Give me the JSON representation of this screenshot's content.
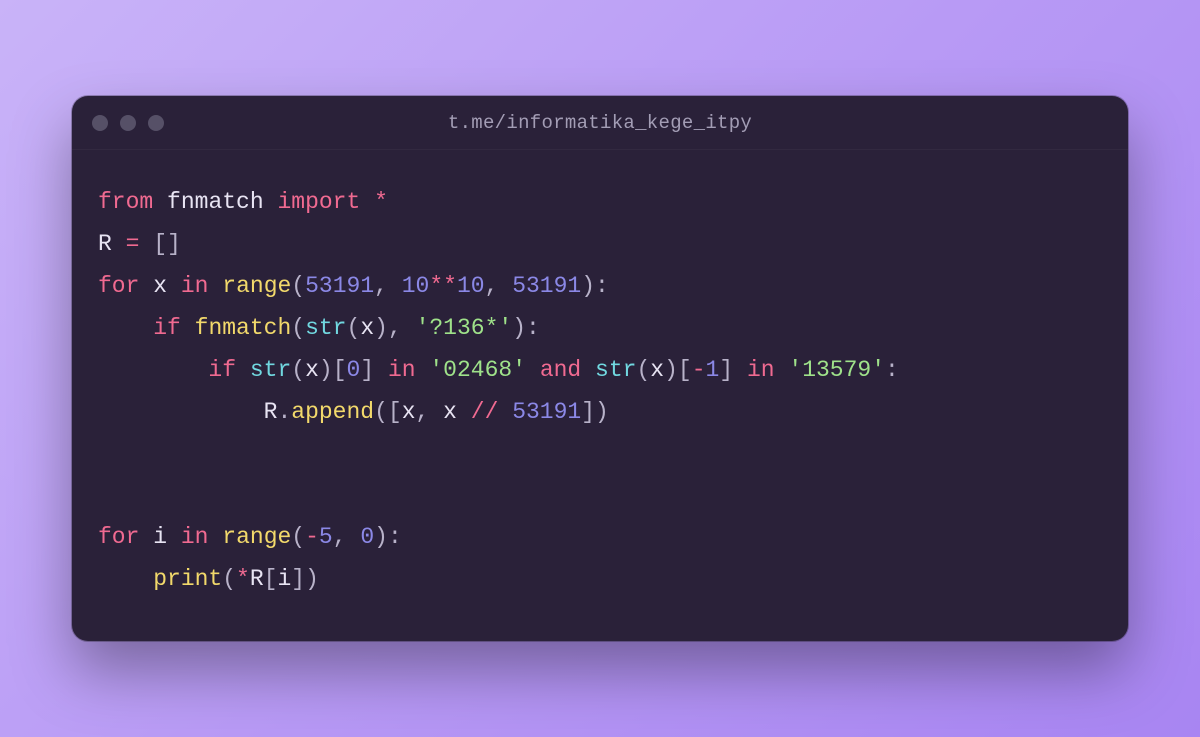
{
  "window": {
    "title": "t.me/informatika_kege_itpy"
  },
  "code": {
    "line1": {
      "kw_from": "from",
      "module": "fnmatch",
      "kw_import": "import",
      "star": "*"
    },
    "line2": {
      "var": "R",
      "eq": "=",
      "lbr": "[",
      "rbr": "]"
    },
    "line3": {
      "kw_for": "for",
      "var": "x",
      "kw_in": "in",
      "fn": "range",
      "lp": "(",
      "n1": "53191",
      "c1": ",",
      "sp1": " ",
      "n2": "10",
      "pow": "**",
      "n3": "10",
      "c2": ",",
      "sp2": " ",
      "n4": "53191",
      "rp": "):"
    },
    "line4": {
      "indent": "    ",
      "kw_if": "if",
      "fn": "fnmatch",
      "lp": "(",
      "bstr": "str",
      "lp2": "(",
      "var": "x",
      "rp2": ")",
      "c1": ",",
      "sp": " ",
      "s": "'?136*'",
      "rp": "):"
    },
    "line5": {
      "indent": "        ",
      "kw_if": "if",
      "bstr1": "str",
      "lp1": "(",
      "var1": "x",
      "rp1": ")",
      "lb1": "[",
      "n0": "0",
      "rb1": "]",
      "kw_in1": "in",
      "s1": "'02468'",
      "kw_and": "and",
      "bstr2": "str",
      "lp2": "(",
      "var2": "x",
      "rp2": ")",
      "lb2": "[",
      "minus": "-",
      "n1": "1",
      "rb2": "]",
      "kw_in2": "in",
      "s2": "'13579'",
      "colon": ":"
    },
    "line6": {
      "indent": "            ",
      "var": "R",
      "dot": ".",
      "fn": "append",
      "lp": "(",
      "lb": "[",
      "x1": "x",
      "c1": ",",
      "sp": " ",
      "x2": "x",
      "fd": "//",
      "n": "53191",
      "rb": "]",
      "rp": ")"
    },
    "line7": {
      "blank": ""
    },
    "line8": {
      "blank": ""
    },
    "line9": {
      "kw_for": "for",
      "var": "i",
      "kw_in": "in",
      "fn": "range",
      "lp": "(",
      "minus": "-",
      "n1": "5",
      "c": ",",
      "sp": " ",
      "n2": "0",
      "rp": "):"
    },
    "line10": {
      "indent": "    ",
      "fn": "print",
      "lp": "(",
      "star": "*",
      "var": "R",
      "lb": "[",
      "i": "i",
      "rb": "]",
      "rp": ")"
    }
  }
}
